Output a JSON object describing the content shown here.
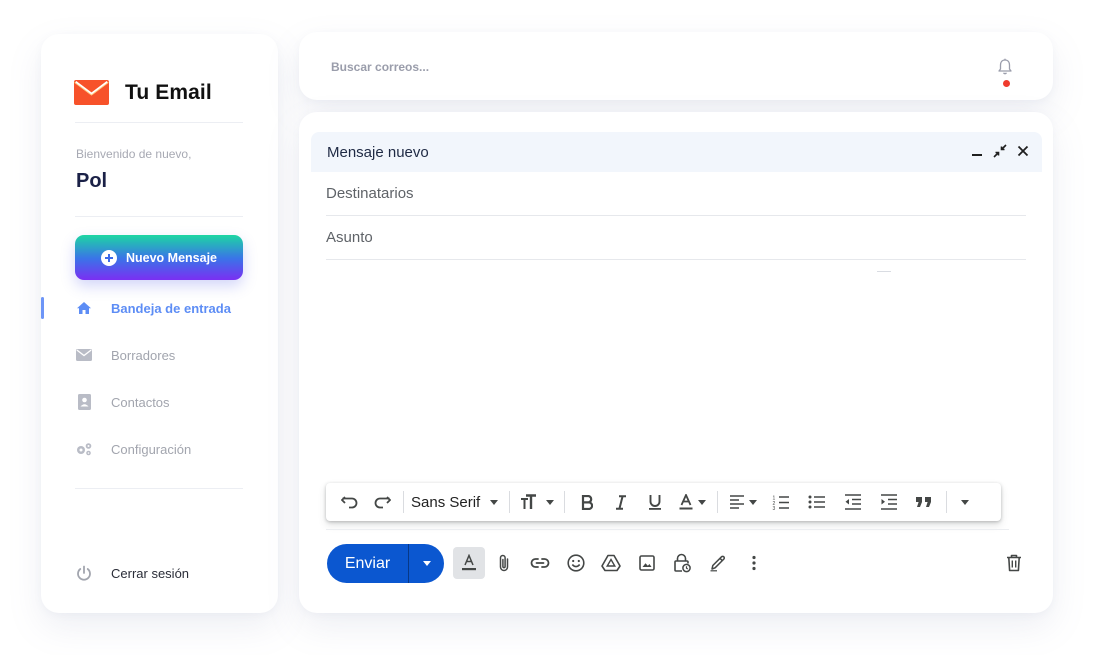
{
  "app": {
    "name": "Tu Email"
  },
  "user": {
    "greeting": "Bienvenido de nuevo,",
    "name": "Pol"
  },
  "sidebar": {
    "new_message_label": "Nuevo Mensaje",
    "items": [
      {
        "label": "Bandeja de entrada",
        "icon": "home-icon",
        "active": true
      },
      {
        "label": "Borradores",
        "icon": "envelope-icon",
        "active": false
      },
      {
        "label": "Contactos",
        "icon": "contact-book-icon",
        "active": false
      },
      {
        "label": "Configuración",
        "icon": "gears-icon",
        "active": false
      }
    ],
    "logout_label": "Cerrar sesión"
  },
  "search": {
    "placeholder": "Buscar correos...",
    "notification_icon": "bell-icon",
    "has_notification": true
  },
  "compose": {
    "title": "Mensaje nuevo",
    "header_icons": [
      "minimize-icon",
      "exit-fullscreen-icon",
      "close-icon"
    ],
    "recipients_placeholder": "Destinatarios",
    "subject_placeholder": "Asunto",
    "font_name": "Sans Serif",
    "send_label": "Enviar",
    "toolbar_icons": [
      "undo-icon",
      "redo-icon",
      "font-family-dropdown",
      "text-size-icon",
      "bold-icon",
      "italic-icon",
      "underline-icon",
      "text-color-icon",
      "align-icon",
      "numbered-list-icon",
      "bulleted-list-icon",
      "indent-less-icon",
      "indent-more-icon",
      "quote-icon",
      "more-formatting-icon"
    ],
    "action_icons": [
      "formatting-options-icon",
      "attach-icon",
      "link-icon",
      "emoji-icon",
      "drive-icon",
      "photo-icon",
      "confidential-mode-icon",
      "signature-icon",
      "more-options-icon",
      "discard-icon"
    ]
  },
  "colors": {
    "accent": "#5d8df5",
    "send": "#0b57d0",
    "notification_dot": "#ef3b2d",
    "logo": "#f6501e"
  }
}
